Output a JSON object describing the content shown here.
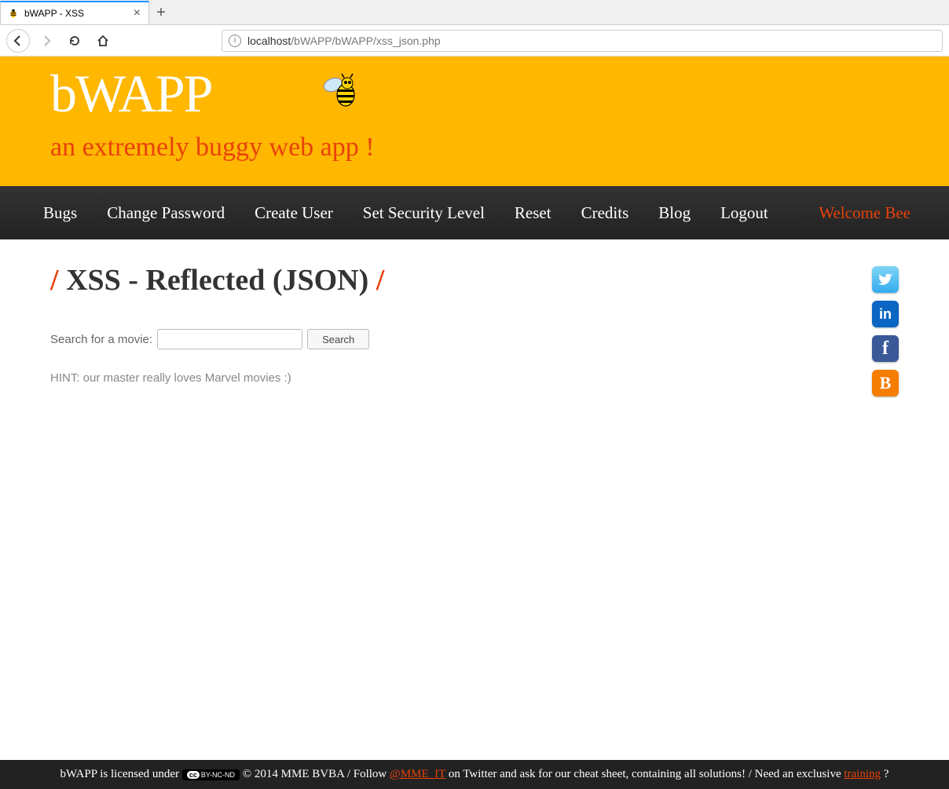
{
  "browser": {
    "tab_title": "bWAPP - XSS",
    "url_host": "localhost",
    "url_path": "/bWAPP/bWAPP/xss_json.php"
  },
  "header": {
    "logo_text": "bWAPP",
    "tagline": "an extremely buggy web app !"
  },
  "nav": {
    "items": [
      "Bugs",
      "Change Password",
      "Create User",
      "Set Security Level",
      "Reset",
      "Credits",
      "Blog",
      "Logout"
    ],
    "welcome": "Welcome Bee"
  },
  "page": {
    "title_text": "XSS - Reflected (JSON)",
    "search_label": "Search for a movie:",
    "search_value": "",
    "search_button": "Search",
    "hint": "HINT: our master really loves Marvel movies :)"
  },
  "social": {
    "twitter": "t",
    "linkedin": "in",
    "facebook": "f",
    "blogger": "B"
  },
  "footer": {
    "text1": "bWAPP is licensed under ",
    "cc_label": "BY-NC-ND",
    "text2": " © 2014 MME BVBA / Follow ",
    "link1": "@MME_IT",
    "text3": " on Twitter and ask for our cheat sheet, containing all solutions! / Need an exclusive ",
    "link2": "training",
    "text4": "?"
  }
}
